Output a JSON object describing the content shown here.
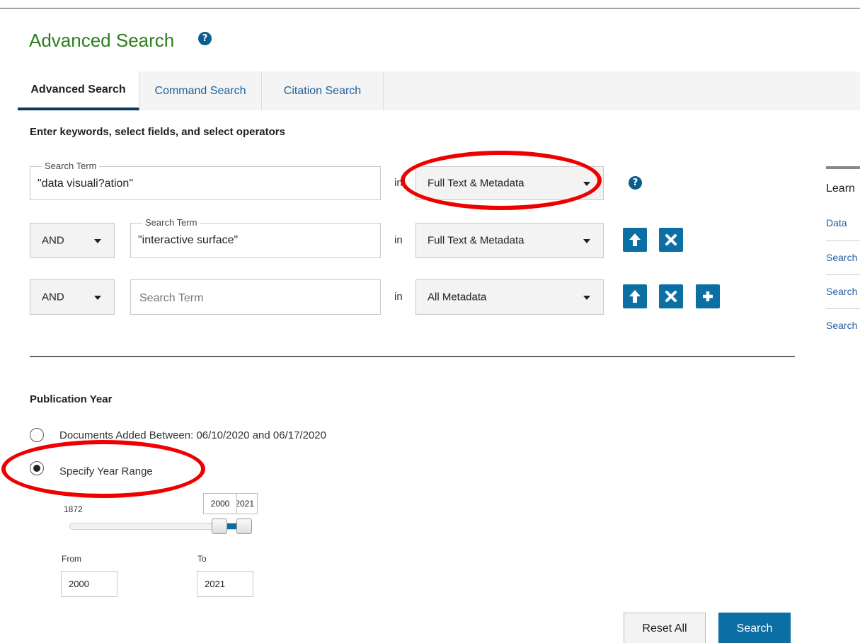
{
  "page": {
    "title": "Advanced Search",
    "title_help_icon": "help-circle-icon"
  },
  "tabs": [
    {
      "label": "Advanced Search",
      "active": true
    },
    {
      "label": "Command Search",
      "active": false
    },
    {
      "label": "Citation Search",
      "active": false
    }
  ],
  "search_form": {
    "heading": "Enter keywords, select fields, and select operators",
    "in_label": "in",
    "rows": [
      {
        "operator": null,
        "term_legend": "Search Term",
        "term_value": "\"data visuali?ation\"",
        "placeholder": "Search Term",
        "field": "Full Text & Metadata",
        "actions": [
          "help-circle-icon"
        ]
      },
      {
        "operator": "AND",
        "term_legend": "Search Term",
        "term_value": "\"interactive surface\"",
        "placeholder": "Search Term",
        "field": "Full Text & Metadata",
        "actions": [
          "arrow-up-icon",
          "close-icon"
        ]
      },
      {
        "operator": "AND",
        "term_legend": "",
        "term_value": "",
        "placeholder": "Search Term",
        "field": "All Metadata",
        "actions": [
          "arrow-up-icon",
          "close-icon",
          "plus-icon"
        ]
      }
    ]
  },
  "publication_year": {
    "heading": "Publication Year",
    "options": [
      {
        "label": "Documents Added Between: 06/10/2020 and 06/17/2020",
        "selected": false
      },
      {
        "label": "Specify Year Range",
        "selected": true
      }
    ],
    "slider": {
      "min_label": "1872",
      "min": 1872,
      "max": 2021,
      "low": 2000,
      "high": 2021,
      "low_tooltip": "2000",
      "high_tooltip": "2021"
    },
    "from_label": "From",
    "to_label": "To",
    "from_value": "2000",
    "to_value": "2021"
  },
  "buttons": {
    "reset": "Reset All",
    "search": "Search"
  },
  "aside": {
    "title": "Learn",
    "links": [
      "Data",
      "Search",
      "Search",
      "Search"
    ]
  },
  "annotations": {
    "color": "#ee0000",
    "circled": [
      "search-field-select-1",
      "specify-year-range-radio"
    ]
  },
  "colors": {
    "primary_blue": "#0b6fa4",
    "title_green": "#2e7d1e",
    "link_blue": "#1f5f9a"
  }
}
